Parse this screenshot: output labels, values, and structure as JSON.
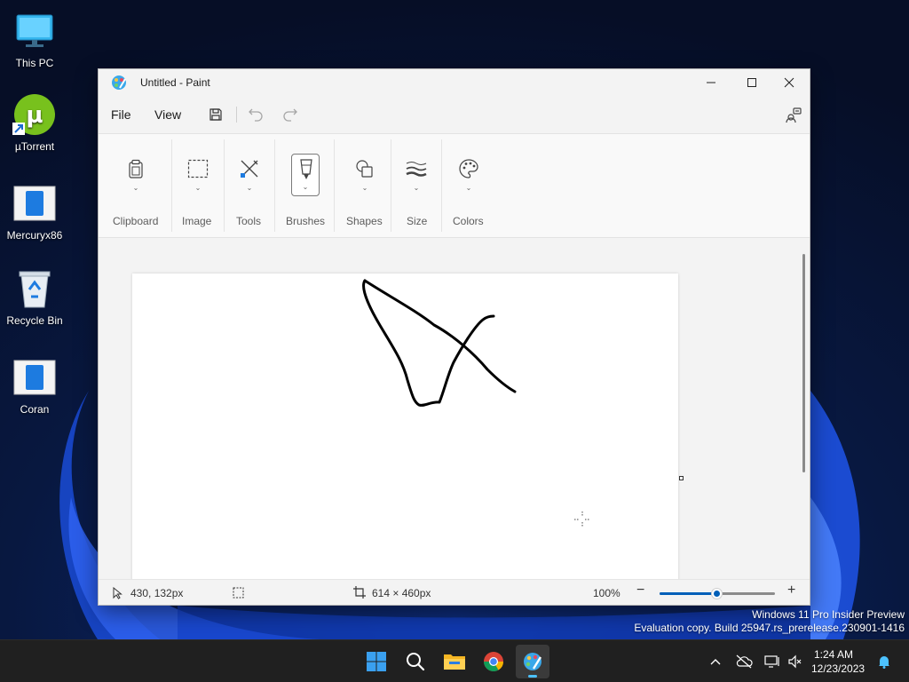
{
  "desktop": {
    "icons": [
      {
        "label": "This PC",
        "icon": "computer-icon"
      },
      {
        "label": "µTorrent",
        "icon": "utorrent-icon"
      },
      {
        "label": "Mercuryx86",
        "icon": "app-icon"
      },
      {
        "label": "Recycle Bin",
        "icon": "recycle-bin-icon"
      },
      {
        "label": "Coran",
        "icon": "app-icon"
      }
    ]
  },
  "window": {
    "title": "Untitled - Paint",
    "menu": {
      "file": "File",
      "view": "View"
    }
  },
  "ribbon": {
    "groups": [
      {
        "label": "Clipboard",
        "icon": "clipboard-icon"
      },
      {
        "label": "Image",
        "icon": "selection-icon"
      },
      {
        "label": "Tools",
        "icon": "tools-icon"
      },
      {
        "label": "Brushes",
        "icon": "brush-icon"
      },
      {
        "label": "Shapes",
        "icon": "shapes-icon"
      },
      {
        "label": "Size",
        "icon": "line-size-icon"
      },
      {
        "label": "Colors",
        "icon": "palette-icon"
      }
    ]
  },
  "status": {
    "cursor_position": "430, 132px",
    "canvas_size": "614 × 460px",
    "zoom": "100%",
    "zoom_fraction": 0.5
  },
  "watermark": {
    "line1": "Windows 11 Pro Insider Preview",
    "line2": "Evaluation copy. Build 25947.rs_prerelease.230901-1416"
  },
  "taskbar": {
    "apps": [
      "start-icon",
      "search-icon",
      "file-explorer-icon",
      "chrome-icon",
      "paint-icon"
    ],
    "time": "1:24 AM",
    "date": "12/23/2023"
  },
  "colors": {
    "accent": "#005fb8",
    "taskbar": "#202020",
    "window_bg": "#f3f3f3"
  }
}
